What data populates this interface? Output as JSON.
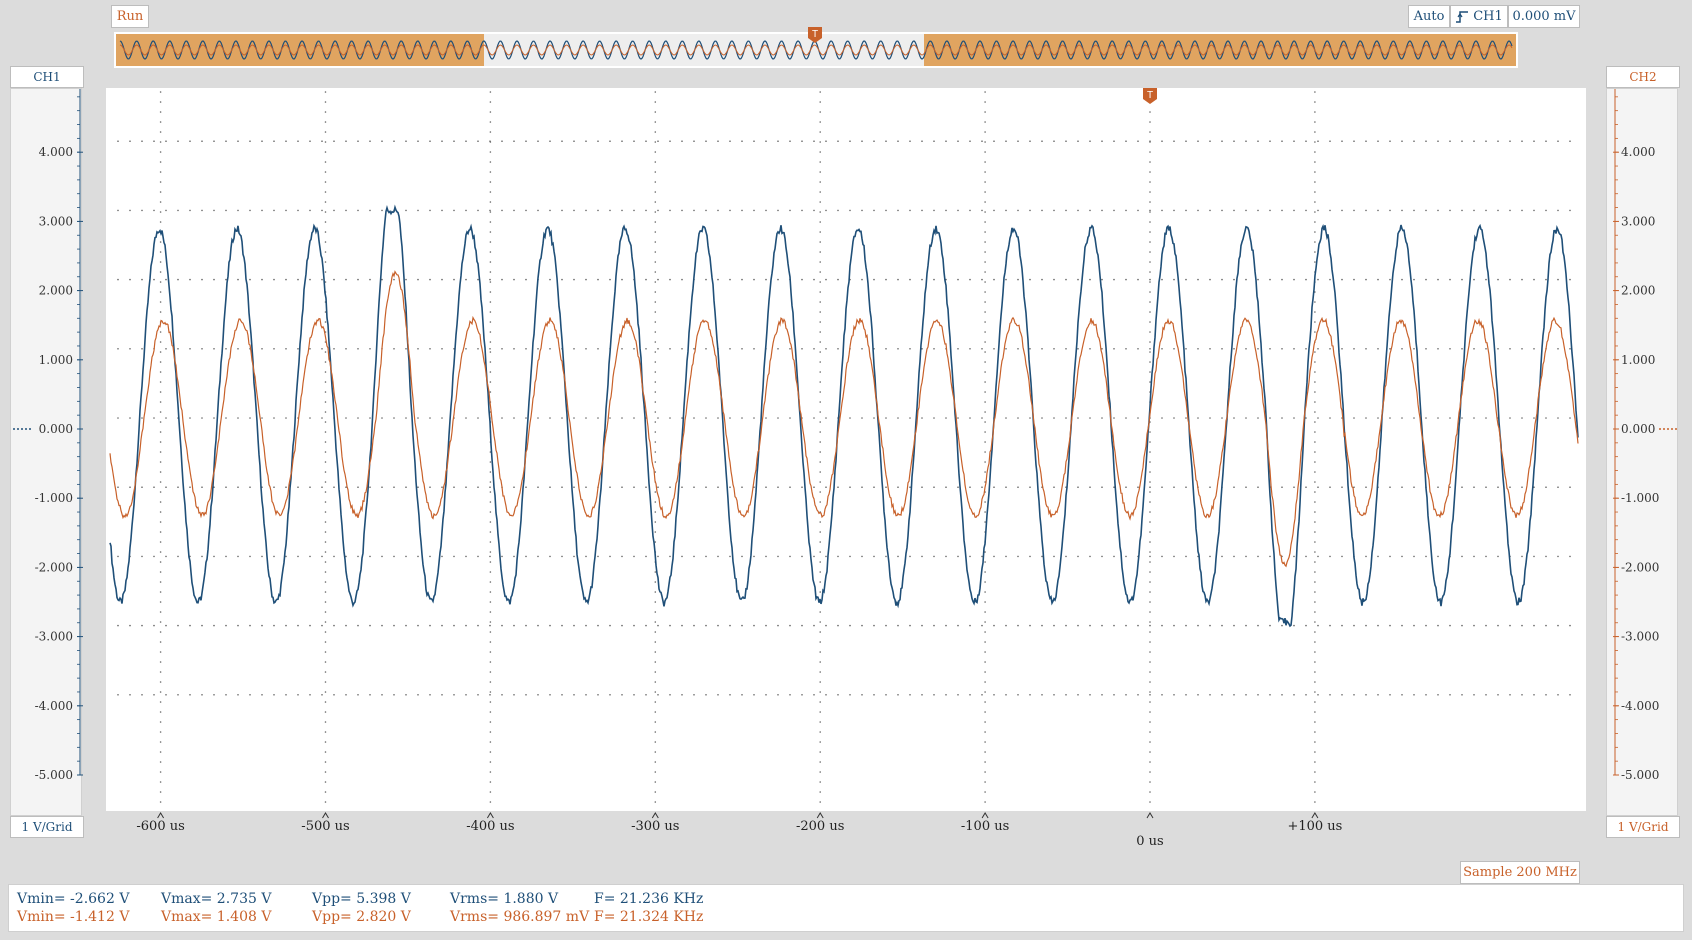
{
  "toolbar": {
    "run_label": "Run",
    "trigger_mode": "Auto",
    "trigger_source": "CH1",
    "trigger_level": "0.000 mV",
    "trigger_marker": "T"
  },
  "channels": {
    "ch1": {
      "label": "CH1",
      "scale": "1 V/Grid",
      "color": "#1f4f78"
    },
    "ch2": {
      "label": "CH2",
      "scale": "1 V/Grid",
      "color": "#c8612a"
    }
  },
  "axes": {
    "y_ticks": [
      "5.000",
      "4.000",
      "3.000",
      "2.000",
      "1.000",
      "0.000",
      "-1.000",
      "-2.000",
      "-3.000",
      "-4.000",
      "-5.000"
    ],
    "x_ticks": [
      "-600 us",
      "-500 us",
      "-400 us",
      "-300 us",
      "-200 us",
      "-100 us",
      "+100 us"
    ],
    "zero_label": "0 us"
  },
  "chart_data": {
    "type": "line",
    "x_unit": "us",
    "y_unit": "V",
    "xlim": [
      -637,
      194
    ],
    "ylim": [
      -5,
      5
    ],
    "series": [
      {
        "name": "CH1",
        "freq_khz": 21.236,
        "max": 2.735,
        "min": -2.662,
        "clip_high": 3.0,
        "clip_low": -2.95,
        "clip_windows": [
          [
            -470,
            -445
          ],
          [
            82,
            100
          ]
        ]
      },
      {
        "name": "CH2",
        "freq_khz": 21.324,
        "max": 1.408,
        "min": -1.412,
        "distorted_windows": [
          [
            -470,
            -445
          ],
          [
            82,
            100
          ]
        ]
      }
    ]
  },
  "sample_rate": "Sample 200 MHz",
  "measurements": {
    "ch1": {
      "vmin": "Vmin= -2.662 V",
      "vmax": "Vmax= 2.735 V",
      "vpp": "Vpp= 5.398 V",
      "vrms": "Vrms= 1.880 V",
      "freq": "F= 21.236 KHz"
    },
    "ch2": {
      "vmin": "Vmin= -1.412 V",
      "vmax": "Vmax= 1.408 V",
      "vpp": "Vpp= 2.820 V",
      "vrms": "Vrms= 986.897 mV",
      "freq": "F= 21.324 KHz"
    }
  },
  "colors": {
    "ch1": "#1f4f78",
    "ch2": "#c8612a",
    "overview_fill": "#e0a460"
  }
}
